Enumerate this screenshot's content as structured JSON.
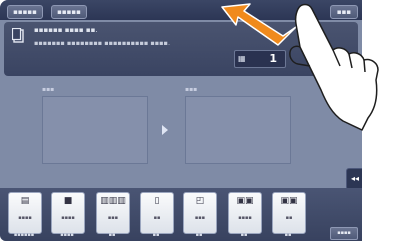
{
  "top_tabs": [
    "▪▪▪▪▪",
    "▪▪▪▪▪",
    "▪▪▪"
  ],
  "message": {
    "line1": "▪▪▪▪▪▪ ▪▪▪▪ ▪▪.",
    "line2": "▪▪▪▪▪▪▪ ▪▪▪▪▪▪▪▪ ▪▪▪▪▪▪▪▪▪▪ ▪▪▪▪."
  },
  "copies": {
    "icon": "keypad-icon",
    "value": "1"
  },
  "panes": {
    "left_label": "▪▪▪",
    "right_label": "▪▪▪"
  },
  "collapse_label": "◂◂",
  "toolbar": {
    "tools": [
      {
        "icon": "copy-icon",
        "glyph": "▤",
        "text": "▪▪▪▪",
        "label": "▪▪▪▪▪▪"
      },
      {
        "icon": "color-icon",
        "glyph": "■",
        "text": "▪▪▪▪",
        "label": "▪▪▪▪"
      },
      {
        "icon": "density-icon",
        "glyph": "▥▥▥",
        "text": "▪▪▪",
        "label": "▪▪"
      },
      {
        "icon": "paper-icon",
        "glyph": "▯",
        "text": "▪▪",
        "label": "▪▪"
      },
      {
        "icon": "zoom-icon",
        "glyph": "◰",
        "text": "▪▪▪",
        "label": "▪▪"
      },
      {
        "icon": "duplex-icon",
        "glyph": "▣▣",
        "text": "▪▪▪▪",
        "label": "▪▪"
      },
      {
        "icon": "combine-icon",
        "glyph": "▣▣",
        "text": "▪▪",
        "label": "▪▪"
      }
    ]
  },
  "right_button_label": "▪▪▪▪"
}
